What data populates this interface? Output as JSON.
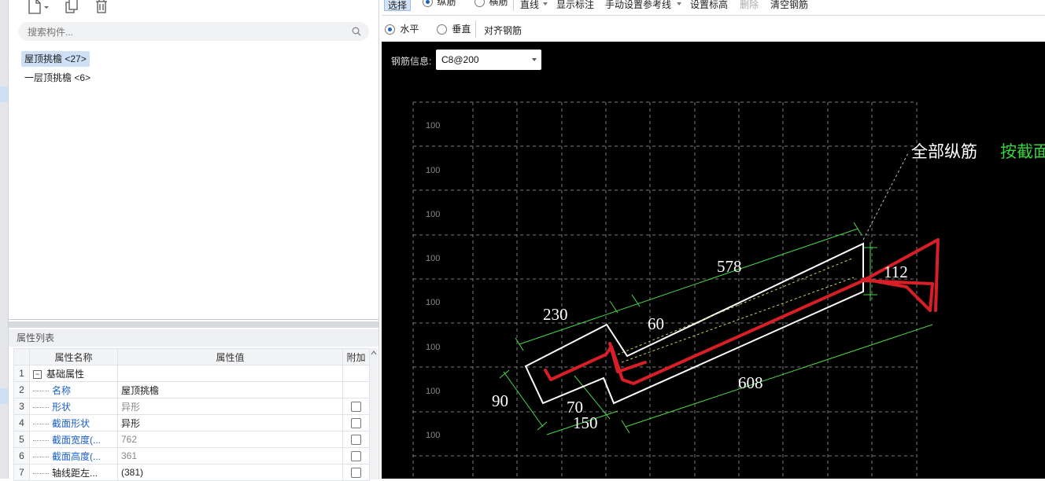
{
  "left_panel": {
    "search_placeholder": "搜索构件...",
    "tree": [
      "屋顶挑檐 <27>",
      "一层顶挑檐 <6>"
    ]
  },
  "properties": {
    "title": "属性列表",
    "headers": {
      "name": "属性名称",
      "value": "属性值",
      "extra": "附加"
    },
    "rows": [
      {
        "num": "1",
        "name": "基础属性",
        "value": "",
        "group": true
      },
      {
        "num": "2",
        "name": "名称",
        "value": "屋顶挑檐",
        "checkbox": false
      },
      {
        "num": "3",
        "name": "形状",
        "value": "异形",
        "checkbox": true
      },
      {
        "num": "4",
        "name": "截面形状",
        "value": "异形",
        "checkbox": true
      },
      {
        "num": "5",
        "name": "截面宽度(...",
        "value": "762",
        "checkbox": true
      },
      {
        "num": "6",
        "name": "截面高度(...",
        "value": "361",
        "checkbox": true
      },
      {
        "num": "7",
        "name": "轴线距左...",
        "value": "(381)",
        "checkbox": true
      }
    ]
  },
  "toolbar": {
    "select": "选择",
    "longitudinal": "纵筋",
    "transverse": "横筋",
    "line": "直线",
    "show_label": "显示标注",
    "manual_ref": "手动设置参考线",
    "set_elev": "设置标高",
    "delete": "删除",
    "clear": "清空钢筋",
    "horizontal": "水平",
    "vertical": "垂直",
    "align": "对齐钢筋"
  },
  "canvas": {
    "rebar_info_label": "钢筋信息:",
    "rebar_info_value": "C8@200",
    "grid_label": "100",
    "annotation_white": "全部纵筋",
    "annotation_green": "按截面",
    "dimensions": [
      "578",
      "112",
      "230",
      "60",
      "608",
      "90",
      "70",
      "150"
    ]
  },
  "colors": {
    "rebar": "#d81e27",
    "dimension": "#49d64a",
    "annotation_green": "#35d43a",
    "canvas": "#000000"
  }
}
